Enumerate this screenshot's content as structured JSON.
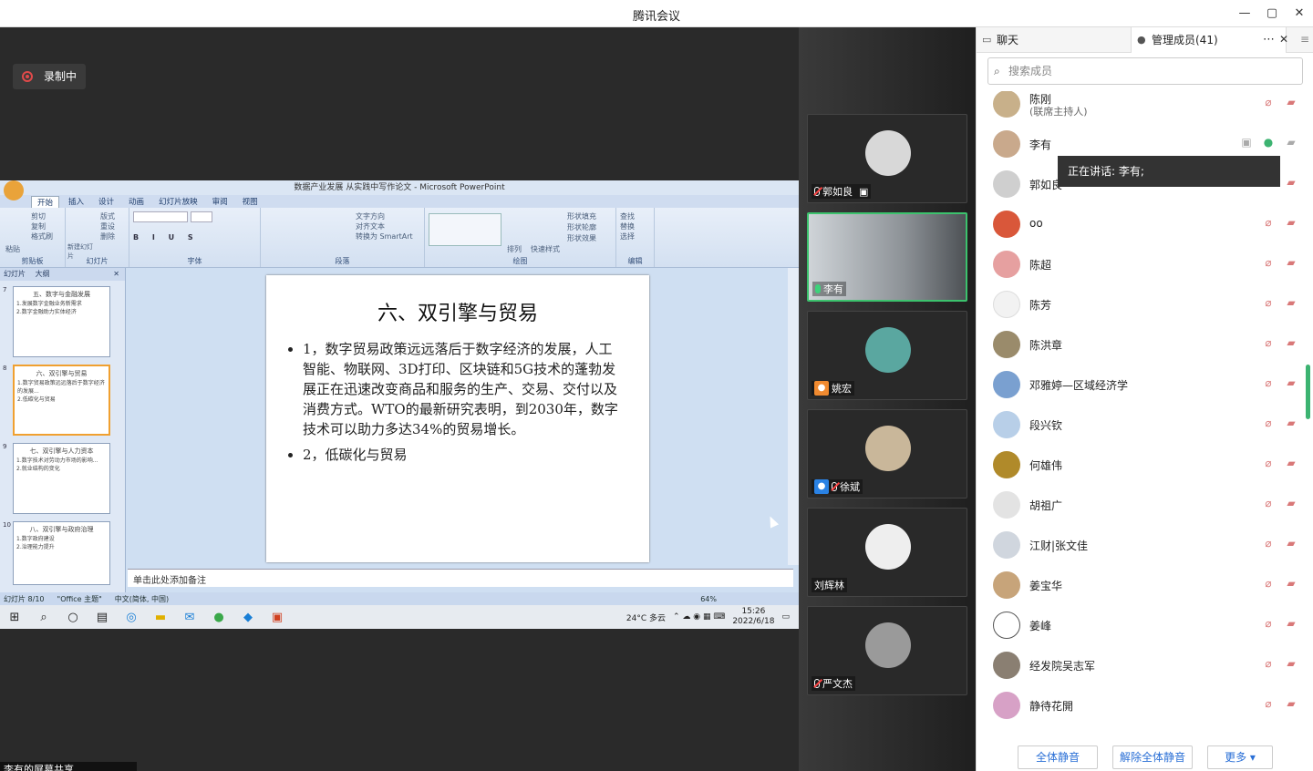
{
  "app_title": "腾讯会议",
  "window_controls": [
    "—",
    "▢",
    "✕"
  ],
  "recording": {
    "label": "录制中"
  },
  "ppt": {
    "window_title": "数据产业发展 从实践中写作论文 - Microsoft PowerPoint",
    "tabs": [
      "开始",
      "插入",
      "设计",
      "动画",
      "幻灯片放映",
      "审阅",
      "视图"
    ],
    "ribbon_groups": [
      "剪贴板",
      "幻灯片",
      "字体",
      "段落",
      "绘图",
      "编辑"
    ],
    "ribbon_items": {
      "clipboard": [
        "剪切",
        "复制",
        "格式刷",
        "粘贴"
      ],
      "slides": [
        "版式",
        "重设",
        "删除",
        "新建幻灯片"
      ],
      "paragraph": [
        "文字方向",
        "对齐文本",
        "转换为 SmartArt"
      ],
      "drawing": [
        "排列",
        "快速样式",
        "形状填充",
        "形状轮廓",
        "形状效果"
      ],
      "editing": [
        "查找",
        "替换",
        "选择"
      ]
    },
    "panel_tabs": [
      "幻灯片",
      "大纲"
    ],
    "thumbnails": [
      {
        "num": "7",
        "title": "五、数字与金融发展",
        "lines": [
          "1.发展数字金融业务新需求",
          "2.数字金融助力实体经济"
        ]
      },
      {
        "num": "8",
        "title": "六、双引擎与贸易",
        "lines": [
          "1.数字贸易政策远远落后于数字经济的发展...",
          "2.低碳化与贸易"
        ]
      },
      {
        "num": "9",
        "title": "七、双引擎与人力资本",
        "lines": [
          "1.数字技术对劳动力市场的影响...",
          "2.就业结构的变化"
        ]
      },
      {
        "num": "10",
        "title": "八、双引擎与政府治理",
        "lines": [
          "1.数字政府建设",
          "2.治理能力提升"
        ]
      }
    ],
    "slide": {
      "title": "六、双引擎与贸易",
      "bullets": [
        "1，数字贸易政策远远落后于数字经济的发展，人工智能、物联网、3D打印、区块链和5G技术的蓬勃发展正在迅速改变商品和服务的生产、交易、交付以及消费方式。WTO的最新研究表明，到2030年，数字技术可以助力多达34%的贸易增长。",
        "2，低碳化与贸易"
      ]
    },
    "notes_placeholder": "单击此处添加备注",
    "status": {
      "slide_info": "幻灯片 8/10",
      "theme": "\"Office 主题\"",
      "language": "中文(简体, 中国)",
      "zoom": "64%"
    }
  },
  "taskbar": {
    "weather": "24°C 多云",
    "time": "15:26",
    "date": "2022/6/18"
  },
  "bottom_label": "李有的屏幕共享",
  "video_tiles": [
    {
      "name": "郭如良",
      "mic": "muted",
      "avatar_color": "#d8d8d8"
    },
    {
      "name": "李有",
      "mic": "on",
      "avatar_color": "#8a8f95",
      "active": true
    },
    {
      "name": "姚宏",
      "mic": "none",
      "avatar_color": "#5aa7a0"
    },
    {
      "name": "徐斌",
      "mic": "muted",
      "avatar_color": "#c9b79a"
    },
    {
      "name": "刘辉林",
      "mic": "none",
      "avatar_color": "#eeeeee"
    },
    {
      "name": "严文杰",
      "mic": "muted",
      "avatar_color": "#9a9a9a"
    }
  ],
  "panel": {
    "tab_chat": "聊天",
    "tab_members": "管理成员(41)",
    "search_placeholder": "搜索成员",
    "speaking_tooltip": "正在讲话: 李有;",
    "members": [
      {
        "name": "陈刚",
        "sub": "(联席主持人)",
        "avatar_color": "#c8b08a"
      },
      {
        "name": "李有",
        "avatar_color": "#c9a98c",
        "speaking": true
      },
      {
        "name": "郭如良",
        "avatar_color": "#cfcfcf"
      },
      {
        "name": "oo",
        "avatar_color": "#d9573a"
      },
      {
        "name": "陈超",
        "avatar_color": "#e6a0a0"
      },
      {
        "name": "陈芳",
        "avatar_color": "#f2f2f2"
      },
      {
        "name": "陈洪章",
        "avatar_color": "#9a8b6b"
      },
      {
        "name": "邓雅婷—区域经济学",
        "avatar_color": "#7aa0d0"
      },
      {
        "name": "段兴钦",
        "avatar_color": "#b8cfe8"
      },
      {
        "name": "何雄伟",
        "avatar_color": "#b08a2a"
      },
      {
        "name": "胡祖广",
        "avatar_color": "#e3e3e3"
      },
      {
        "name": "江财|张文佳",
        "avatar_color": "#d0d6de"
      },
      {
        "name": "姜宝华",
        "avatar_color": "#c7a47a"
      },
      {
        "name": "姜峰",
        "avatar_color": "#ffffff"
      },
      {
        "name": "经发院吴志军",
        "avatar_color": "#8a7f72"
      },
      {
        "name": "静待花開",
        "avatar_color": "#d7a1c6"
      }
    ],
    "footer_buttons": [
      "全体静音",
      "解除全体静音",
      "更多 ▾"
    ]
  }
}
